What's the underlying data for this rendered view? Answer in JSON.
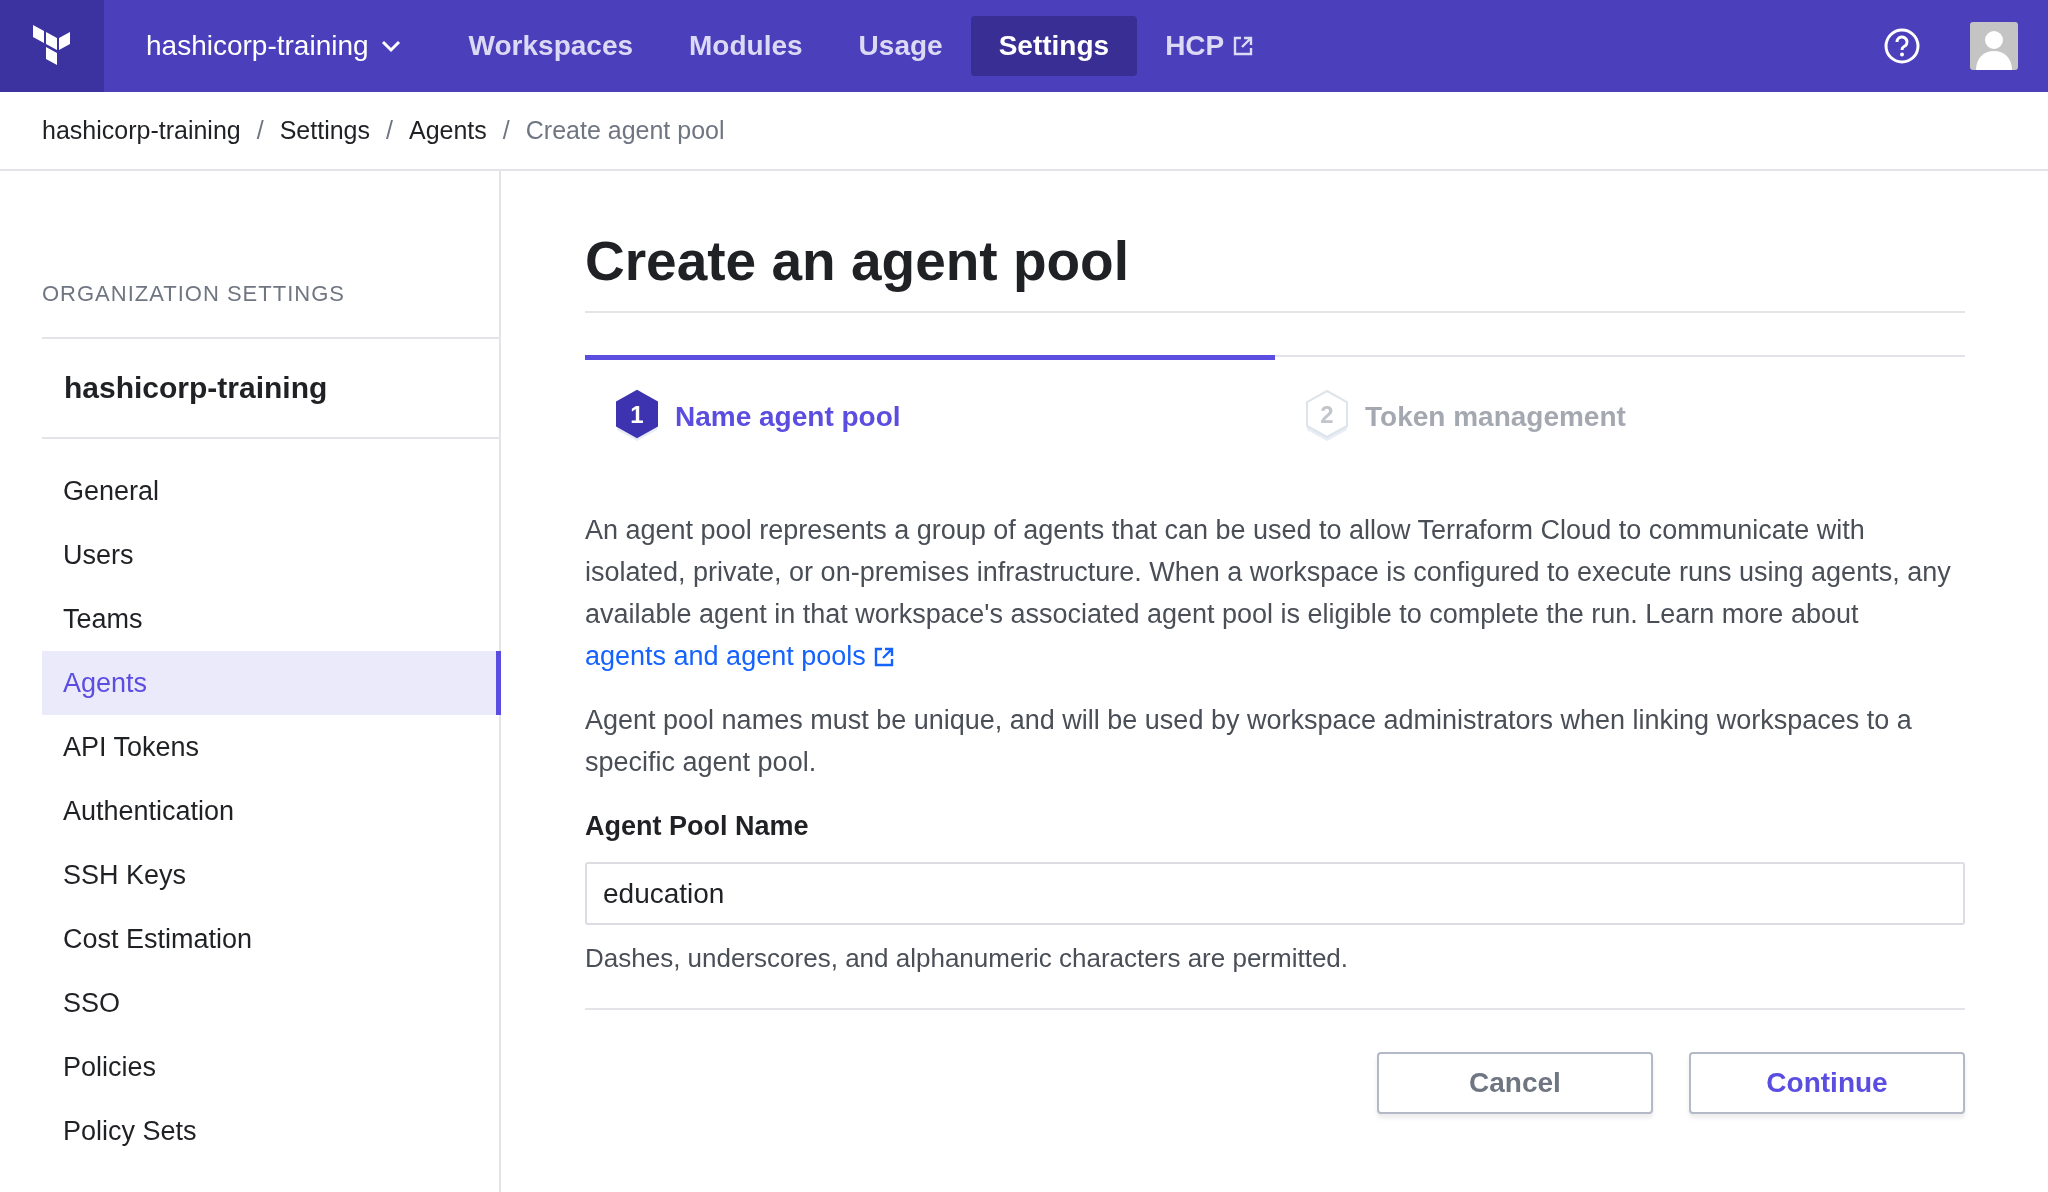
{
  "nav": {
    "org": "hashicorp-training",
    "items": [
      {
        "label": "Workspaces",
        "selected": false,
        "kind": "plain"
      },
      {
        "label": "Modules",
        "selected": false,
        "kind": "plain"
      },
      {
        "label": "Usage",
        "selected": false,
        "kind": "plain"
      },
      {
        "label": "Settings",
        "selected": true,
        "kind": "plain"
      },
      {
        "label": "HCP",
        "selected": false,
        "kind": "external"
      }
    ]
  },
  "breadcrumbs": [
    {
      "label": "hashicorp-training",
      "current": false
    },
    {
      "label": "Settings",
      "current": false
    },
    {
      "label": "Agents",
      "current": false
    },
    {
      "label": "Create agent pool",
      "current": true
    }
  ],
  "breadcrumb_separator": "/",
  "sidebar": {
    "heading": "ORGANIZATION SETTINGS",
    "org": "hashicorp-training",
    "items": [
      {
        "label": "General",
        "selected": false
      },
      {
        "label": "Users",
        "selected": false
      },
      {
        "label": "Teams",
        "selected": false
      },
      {
        "label": "Agents",
        "selected": true
      },
      {
        "label": "API Tokens",
        "selected": false
      },
      {
        "label": "Authentication",
        "selected": false
      },
      {
        "label": "SSH Keys",
        "selected": false
      },
      {
        "label": "Cost Estimation",
        "selected": false
      },
      {
        "label": "SSO",
        "selected": false
      },
      {
        "label": "Policies",
        "selected": false
      },
      {
        "label": "Policy Sets",
        "selected": false
      }
    ]
  },
  "page_title": "Create an agent pool",
  "steps": [
    {
      "number": "1",
      "label": "Name agent pool",
      "selected": true
    },
    {
      "number": "2",
      "label": "Token management",
      "selected": false
    }
  ],
  "intro": {
    "text": "An agent pool represents a group of agents that can be used to allow Terraform Cloud to communicate with isolated, private, or on-premises infrastructure. When a workspace is configured to execute runs using agents, any available agent in that workspace's associated agent pool is eligible to complete the run. Learn more about",
    "link": "agents and agent pools"
  },
  "note": "Agent pool names must be unique, and will be used by workspace administrators when linking workspaces to a specific agent pool.",
  "field": {
    "label": "Agent Pool Name",
    "value": "education",
    "help": "Dashes, underscores, and alphanumeric characters are permitted."
  },
  "buttons": [
    {
      "label": "Cancel",
      "kind": "secondary"
    },
    {
      "label": "Continue",
      "kind": "primary"
    }
  ]
}
